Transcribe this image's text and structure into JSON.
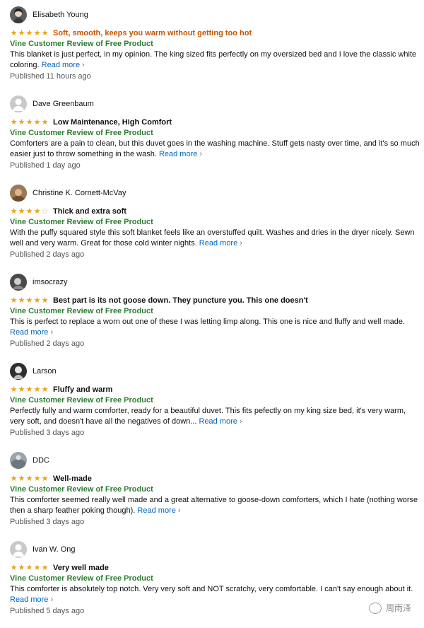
{
  "reviews": [
    {
      "user": "Elisabeth Young",
      "avatar": "portrait-photo",
      "rating": 5,
      "title": "Soft, smooth, keeps you warm without getting too hot",
      "vine": "Vine Customer Review of Free Product",
      "body": "This blanket is just perfect, in my opinion. The king sized fits perfectly on my oversized bed and I love the classic white coloring.",
      "read_more": "Read more",
      "published": "Published 11 hours ago"
    },
    {
      "user": "Dave Greenbaum",
      "avatar": "default-user",
      "rating": 5,
      "title": "Low Maintenance, High Comfort",
      "vine": "Vine Customer Review of Free Product",
      "body": "Comforters are a pain to clean, but this duvet goes in the washing machine. Stuff gets nasty over time, and it's so much easier just to throw something in the wash.",
      "read_more": "Read more",
      "published": "Published 1 day ago"
    },
    {
      "user": "Christine K. Cornett-McVay",
      "avatar": "photo",
      "rating": 4,
      "title": "Thick and extra soft",
      "vine": "Vine Customer Review of Free Product",
      "body": "With the puffy squared style this soft blanket feels like an overstuffed quilt. Washes and dries in the dryer nicely. Sewn well and very warm. Great for those cold winter nights.",
      "read_more": "Read more",
      "published": "Published 2 days ago"
    },
    {
      "user": "imsocrazy",
      "avatar": "photo",
      "rating": 5,
      "title": "Best part is its not goose down. They puncture you. This one doesn't",
      "vine": "Vine Customer Review of Free Product",
      "body": "This is perfect to replace a worn out one of these I was letting limp along. This one is nice and fluffy and well made.",
      "read_more": "Read more",
      "published": "Published 2 days ago"
    },
    {
      "user": "Larson",
      "avatar": "photo",
      "rating": 5,
      "title": "Fluffy and warm",
      "vine": "Vine Customer Review of Free Product",
      "body": "Perfectly fully and warm comforter, ready for a beautiful duvet. This fits pefectly on my king size bed, it's very warm, very soft, and doesn't have all the negatives of down...",
      "read_more": "Read more",
      "published": "Published 3 days ago"
    },
    {
      "user": "DDC",
      "avatar": "photo",
      "rating": 5,
      "title": "Well-made",
      "vine": "Vine Customer Review of Free Product",
      "body": "This comforter seemed really well made and a great alternative to goose-down comforters, which I hate (nothing worse then a sharp feather poking though).",
      "read_more": "Read more",
      "published": "Published 3 days ago"
    },
    {
      "user": "Ivan W. Ong",
      "avatar": "default-user",
      "rating": 5,
      "title": "Very well made",
      "vine": "Vine Customer Review of Free Product",
      "body": "This comforter is absolutely top notch. Very very soft and NOT scratchy, very comfortable. I can't say enough about it.",
      "read_more": "Read more",
      "published": "Published 5 days ago"
    }
  ],
  "watermark": {
    "icon": "wechat-icon",
    "text": "周雨泽"
  },
  "colors": {
    "star": "#e8a317",
    "vine": "#2e7d32",
    "highlight_title": "#c45500",
    "link": "#0066c0"
  }
}
